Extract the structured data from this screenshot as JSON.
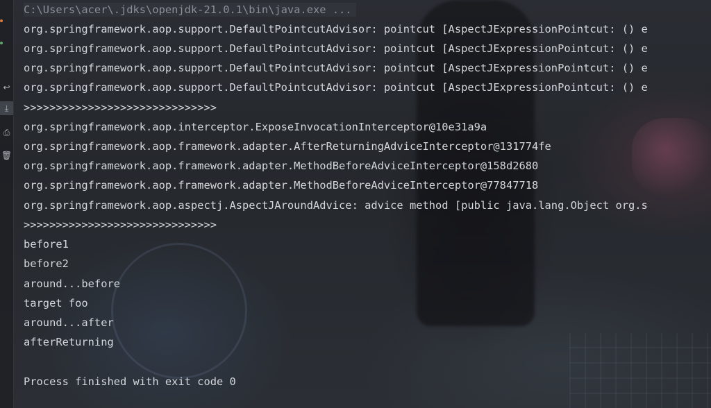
{
  "colors": {
    "background": "#2a2d33",
    "text": "#d4d7dc",
    "command_text": "#8a8f98",
    "gutter_dot_orange": "#e07b3a",
    "gutter_dot_green": "#5fa86b"
  },
  "gutter": {
    "buttons": [
      {
        "icon": "soft-wrap-icon",
        "glyph": "↩"
      },
      {
        "icon": "scroll-to-end-icon",
        "glyph": "⤓"
      },
      {
        "icon": "print-icon",
        "glyph": "⎙"
      },
      {
        "icon": "trash-icon",
        "glyph": "🗑"
      }
    ]
  },
  "console": {
    "command": "C:\\Users\\acer\\.jdks\\openjdk-21.0.1\\bin\\java.exe ...",
    "lines": [
      "org.springframework.aop.support.DefaultPointcutAdvisor: pointcut [AspectJExpressionPointcut: () e",
      "org.springframework.aop.support.DefaultPointcutAdvisor: pointcut [AspectJExpressionPointcut: () e",
      "org.springframework.aop.support.DefaultPointcutAdvisor: pointcut [AspectJExpressionPointcut: () e",
      "org.springframework.aop.support.DefaultPointcutAdvisor: pointcut [AspectJExpressionPointcut: () e",
      ">>>>>>>>>>>>>>>>>>>>>>>>>>>>>>",
      "org.springframework.aop.interceptor.ExposeInvocationInterceptor@10e31a9a",
      "org.springframework.aop.framework.adapter.AfterReturningAdviceInterceptor@131774fe",
      "org.springframework.aop.framework.adapter.MethodBeforeAdviceInterceptor@158d2680",
      "org.springframework.aop.framework.adapter.MethodBeforeAdviceInterceptor@77847718",
      "org.springframework.aop.aspectj.AspectJAroundAdvice: advice method [public java.lang.Object org.s",
      ">>>>>>>>>>>>>>>>>>>>>>>>>>>>>>",
      "before1",
      "before2",
      "around...before",
      "target foo",
      "around...after",
      "afterReturning",
      "",
      "Process finished with exit code 0"
    ]
  }
}
